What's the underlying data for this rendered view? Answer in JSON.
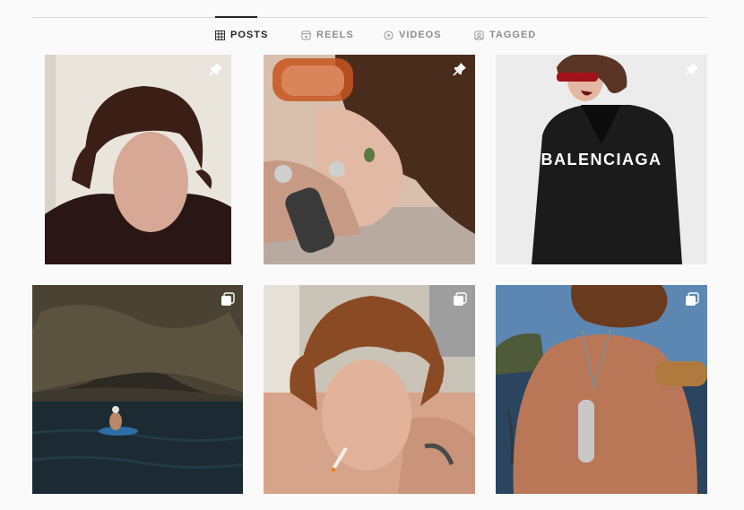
{
  "tabs": [
    {
      "label": "POSTS",
      "icon": "grid-icon",
      "active": true
    },
    {
      "label": "REELS",
      "icon": "reels-icon",
      "active": false
    },
    {
      "label": "VIDEOS",
      "icon": "play-icon",
      "active": false
    },
    {
      "label": "TAGGED",
      "icon": "tagged-icon",
      "active": false
    }
  ],
  "posts": [
    {
      "badge": "pin-icon"
    },
    {
      "badge": "pin-icon"
    },
    {
      "badge": "pin-icon",
      "overlay_text": "BALENCIAGA"
    },
    {
      "badge": "carousel-icon"
    },
    {
      "badge": "carousel-icon"
    },
    {
      "badge": "carousel-icon"
    }
  ]
}
